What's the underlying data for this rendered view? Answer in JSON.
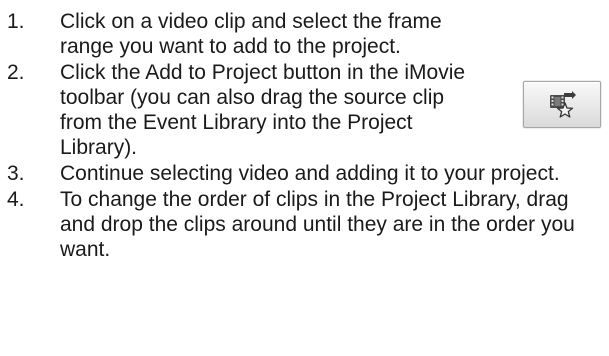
{
  "steps": [
    {
      "number": "1.",
      "text": "Click on a video clip and select the frame range you want to add to the project."
    },
    {
      "number": "2.",
      "text": "Click the Add to Project button in the iMovie toolbar (you can also drag the source clip from the Event Library into the Project Library)."
    },
    {
      "number": "3.",
      "text": "Continue selecting video and adding it to your project."
    },
    {
      "number": "4.",
      "text": "To change the order of clips in the Project Library, drag and drop the clips around until they are in the order you want."
    }
  ],
  "toolbar": {
    "add_to_project_icon": "add-to-project-icon"
  }
}
